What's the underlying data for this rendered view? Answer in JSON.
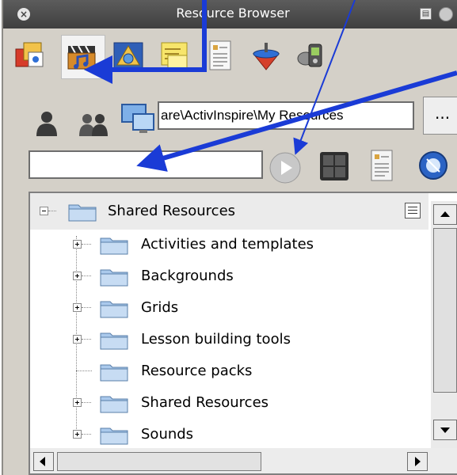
{
  "window": {
    "title": "Resource Browser"
  },
  "toolbar": {
    "icons": [
      "resources-icon",
      "media-icon",
      "geometry-icon",
      "notes-icon",
      "page-icon",
      "spinning-top-icon",
      "devices-icon"
    ]
  },
  "location": {
    "user_icons": [
      "single-user-icon",
      "group-users-icon",
      "computer-icon"
    ],
    "path": "are\\ActivInspire\\My Resources",
    "browse_label": "..."
  },
  "search": {
    "value": "",
    "placeholder": ""
  },
  "tree": {
    "root": "Shared Resources",
    "items": [
      {
        "label": "Activities and templates",
        "expandable": true
      },
      {
        "label": "Backgrounds",
        "expandable": true
      },
      {
        "label": "Grids",
        "expandable": true
      },
      {
        "label": "Lesson building tools",
        "expandable": true
      },
      {
        "label": "Resource packs",
        "expandable": false
      },
      {
        "label": "Shared Resources",
        "expandable": true
      },
      {
        "label": "Sounds",
        "expandable": true
      }
    ]
  },
  "colors": {
    "annotation_arrow": "#1a3bd6",
    "titlebar": "#4a4a4a",
    "window_bg": "#d4d0c8"
  }
}
